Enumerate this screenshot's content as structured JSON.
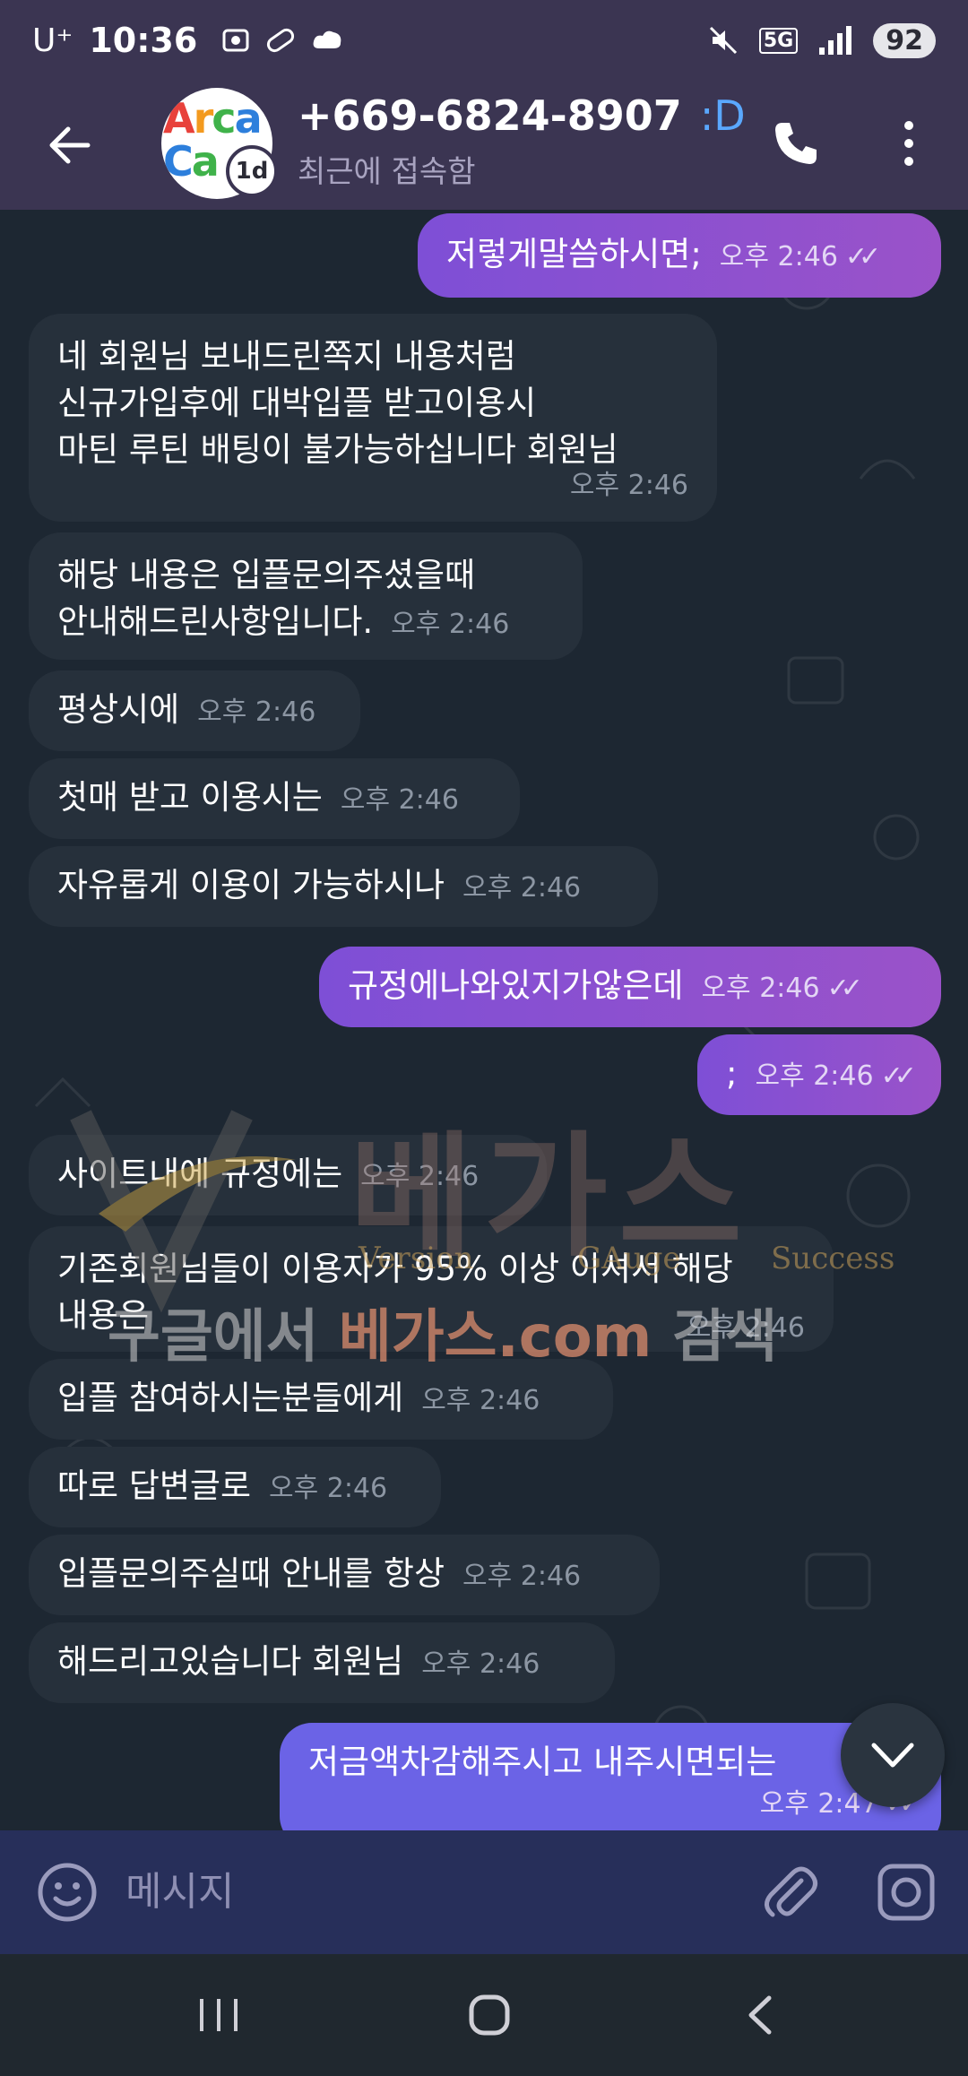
{
  "status_bar": {
    "carrier": "U⁺",
    "time": "10:36",
    "network": "5G",
    "battery": "92"
  },
  "header": {
    "contact_name": "+669-6824-8907",
    "name_emoji": ":D",
    "last_seen": "최근에 접속함",
    "avatar_line1": [
      "A",
      "r",
      "c",
      "a"
    ],
    "avatar_line2": [
      "C",
      "a"
    ],
    "story_badge": "1d"
  },
  "messages": [
    {
      "dir": "out",
      "text": "저렇게말씀하시면;",
      "time": "오후 2:46"
    },
    {
      "dir": "in",
      "lines": [
        "네 회원님 보내드린쪽지 내용처럼",
        "신규가입후에 대박입플 받고이용시",
        "마틴 루틴 배팅이 불가능하십니다 회원님"
      ],
      "time": "오후 2:46"
    },
    {
      "dir": "in",
      "lines": [
        "해당 내용은 입플문의주셨을때",
        "안내해드린사항입니다."
      ],
      "time": "오후 2:46"
    },
    {
      "dir": "in",
      "text": "평상시에",
      "time": "오후 2:46"
    },
    {
      "dir": "in",
      "text": "첫매 받고 이용시는",
      "time": "오후 2:46"
    },
    {
      "dir": "in",
      "text": "자유롭게 이용이 가능하시나",
      "time": "오후 2:46"
    },
    {
      "dir": "out",
      "text": "규정에나와있지가않은데",
      "time": "오후 2:46"
    },
    {
      "dir": "out",
      "text": ";",
      "time": "오후 2:46"
    },
    {
      "dir": "in",
      "text": "사이트내에 규정에는",
      "time": "오후 2:46"
    },
    {
      "dir": "in",
      "lines": [
        "기존회원님들이 이용자가 95% 이상 이셔서 해당",
        "내용은"
      ],
      "time": "오후 2:46"
    },
    {
      "dir": "in",
      "text": "입플 참여하시는분들에게",
      "time": "오후 2:46"
    },
    {
      "dir": "in",
      "text": "따로 답변글로",
      "time": "오후 2:46"
    },
    {
      "dir": "in",
      "text": "입플문의주실때 안내를 항상",
      "time": "오후 2:46"
    },
    {
      "dir": "in",
      "text": "해드리고있습니다 회원님",
      "time": "오후 2:46"
    },
    {
      "dir": "out",
      "text": "저금액차감해주시고 내주시면되는",
      "time": "오후 2:47"
    }
  ],
  "watermark": {
    "brand": "베가스",
    "sub": [
      "Version",
      "GAuge",
      "Success"
    ],
    "search_prefix": "구글에서 ",
    "search_accent": "베가스.com",
    "search_suffix": " 검색"
  },
  "input": {
    "placeholder": "메시지"
  },
  "colors": {
    "header_bg": "#3b3552",
    "chat_bg": "#1d2732",
    "incoming_bubble": "#26303b",
    "outgoing_bubble": "#8a50d0",
    "input_bar_bg": "#272f5a"
  },
  "icons": {
    "back": "arrow-left-icon",
    "call": "phone-icon",
    "more": "more-vertical-icon",
    "emoji": "smiley-icon",
    "attach": "paperclip-icon",
    "camera": "camera-icon",
    "scroll_down": "chevron-down-icon"
  }
}
